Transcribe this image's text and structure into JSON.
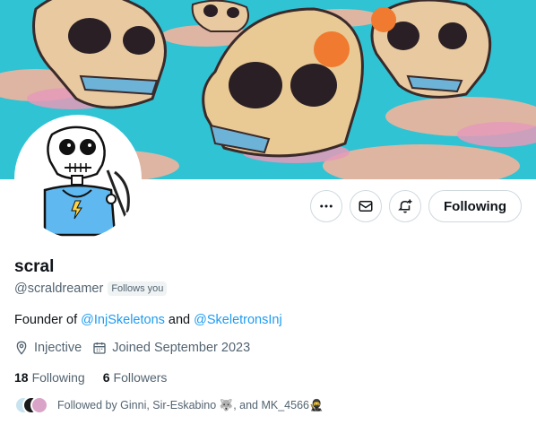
{
  "profile": {
    "name": "scral",
    "handle": "@scraldreamer",
    "follows_you": "Follows you",
    "bio": {
      "prefix": "Founder of ",
      "mention1": "@InjSkeletons",
      "middle": " and ",
      "mention2": "@SkeletronsInj"
    },
    "location": "Injective",
    "joined": "Joined September 2023",
    "following_count": "18",
    "following_label": "Following",
    "followers_count": "6",
    "followers_label": "Followers",
    "followed_by": "Followed by Ginni, Sir-Eskabino 🐺, and MK_4566🥷"
  },
  "actions": {
    "follow_label": "Following",
    "more_icon": "more-icon",
    "message_icon": "envelope-icon",
    "notify_icon": "bell-plus-icon"
  },
  "colors": {
    "accent": "#1d9bf0",
    "banner_sky": "#2ec4d6",
    "secondary_text": "#536471"
  }
}
